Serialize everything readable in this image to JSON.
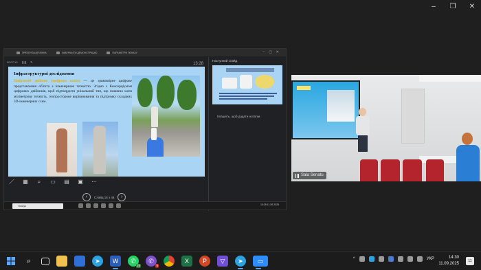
{
  "window": {
    "controls": [
      "–",
      "❐",
      "✕"
    ]
  },
  "share": {
    "tabs": [
      {
        "label": "ПРЕЗЕНТАЦІЯ ВІКНА"
      },
      {
        "label": "ЗАВЕРШИТИ ДЕМОНСТРАЦІЮ"
      },
      {
        "label": "ПАРАМЕТРИ ПОКАЗУ"
      }
    ],
    "timer": "00:07:13",
    "clock": "13:28",
    "slide": {
      "title": "Інфраструктурні дослідження",
      "highlight": "Цифровий двійник (цифрова копія)",
      "body": " — це тривимірне цифрове представлення об'єкта з інженерною точністю. Згідно з Консорціумом цифрових двійників, щоб підтвердити унікальний тип, що повинно мати міліметрову точність, геопросторове вирівнювання та підтримку складних 3D-інженерних схем."
    },
    "slide_counter": "Слайд 16 з 46",
    "next_label": "Наступний слайд",
    "notes_placeholder": "Клацніть, щоб додати нотатки",
    "inner_search": "Пошук",
    "inner_tray": "13:28 11.09.2025"
  },
  "video": {
    "participant": "Sala Senatu"
  },
  "taskbar": {
    "whatsapp_badge": "28",
    "viber_badge": "5",
    "language": "УКР",
    "time": "14:30",
    "date": "11.09.2025",
    "notifications": "11"
  },
  "colors": {
    "slide_bg": "#a9d4f4",
    "highlight": "#e3b000",
    "taskbar_bg": "#1c1c1c"
  }
}
